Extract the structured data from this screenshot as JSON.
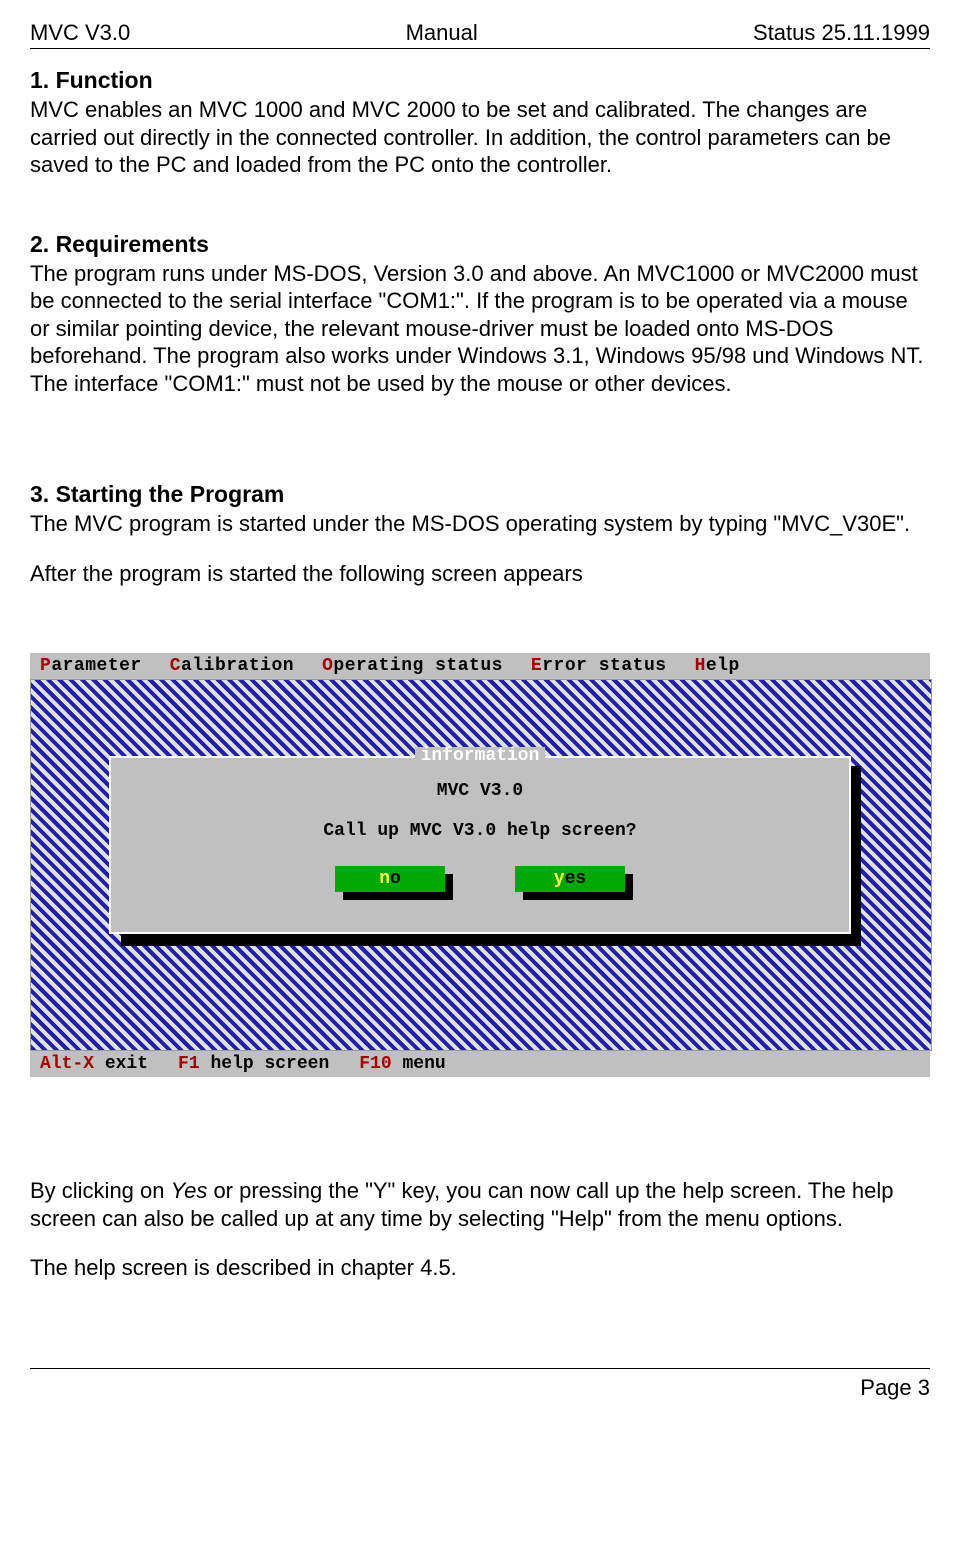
{
  "header": {
    "left": "MVC V3.0",
    "center": "Manual",
    "right": "Status 25.11.1999"
  },
  "sections": {
    "s1": {
      "title": "1. Function",
      "body": "MVC enables an MVC 1000 and MVC 2000 to be set and calibrated.  The changes are carried out directly in the connected controller.  In addition, the control parameters can be saved to the PC and loaded from the PC onto the controller."
    },
    "s2": {
      "title": "2. Requirements",
      "body": "The program runs under MS-DOS, Version 3.0 and above. An MVC1000 or MVC2000 must be connected to the serial interface \"COM1:\".   If the program is to be operated via a mouse or similar pointing device, the relevant mouse-driver must be loaded onto MS-DOS beforehand.  The program also works under Windows 3.1, Windows 95/98 und Windows NT.  The interface \"COM1:\" must not be used by the mouse or other devices."
    },
    "s3": {
      "title": "3. Starting the Program",
      "body1": "The MVC program is started under the MS-DOS operating system by typing \"MVC_V30E\".",
      "body2": "After the program is started the following screen appears"
    },
    "after": {
      "p1a": "By clicking on ",
      "p1yes": "Yes",
      "p1b": " or pressing the \"Y\" key, you can now call up the help screen.  The help screen can also be called up at any time by selecting \"Help\" from the menu options.",
      "p2": "The help screen is described in chapter 4.5."
    }
  },
  "dos": {
    "menu": {
      "m0": {
        "hot": "P",
        "rest": "arameter"
      },
      "m1": {
        "hot": "C",
        "rest": "alibration"
      },
      "m2": {
        "hot": "O",
        "rest": "perating status"
      },
      "m3": {
        "hot": "E",
        "rest": "rror status"
      },
      "m4": {
        "hot": "H",
        "rest": "elp"
      }
    },
    "dialog": {
      "title": "information",
      "heading": "MVC V3.0",
      "text": "Call up MVC V3.0 help screen?",
      "btn_no": {
        "hot": "n",
        "rest": "o"
      },
      "btn_yes": {
        "hot": "y",
        "rest": "es"
      }
    },
    "status": {
      "s0": {
        "hot": "Alt-X",
        "rest": " exit"
      },
      "s1": {
        "hot": "F1",
        "rest": " help screen"
      },
      "s2": {
        "hot": "F10",
        "rest": " menu"
      }
    }
  },
  "footer": {
    "page": "Page 3"
  }
}
